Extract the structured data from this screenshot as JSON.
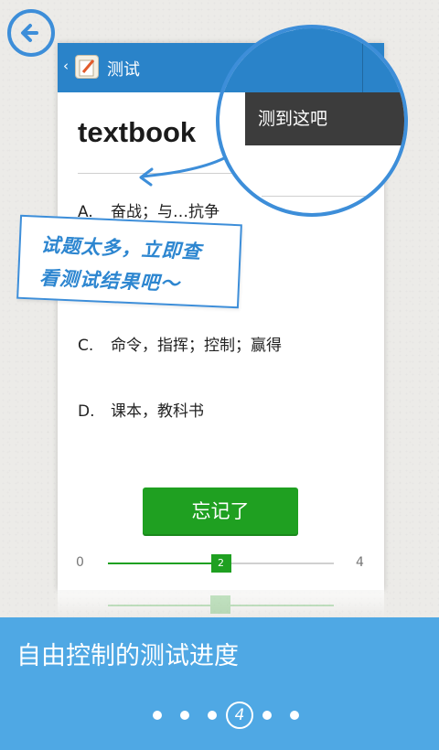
{
  "appbar": {
    "back_glyph": "‹",
    "title": "测试"
  },
  "question": {
    "word": "textbook"
  },
  "options": [
    {
      "letter": "A.",
      "text": "奋战；与…抗争"
    },
    {
      "letter": "C.",
      "text": "命令，指挥；控制；赢得"
    },
    {
      "letter": "D.",
      "text": "课本，教科书"
    }
  ],
  "forget_button": "忘记了",
  "progress": {
    "min": "0",
    "max": "4",
    "current": "2",
    "fraction": 0.5
  },
  "magnifier": {
    "menu_item": "测到这吧"
  },
  "note": {
    "line1": "试题太多，立即查",
    "line2": "看测试结果吧～"
  },
  "banner": {
    "caption": "自由控制的测试进度",
    "active_page": "4"
  },
  "colors": {
    "accent": "#2a83c9",
    "green": "#1fa021",
    "banner": "#4fa8e4"
  }
}
